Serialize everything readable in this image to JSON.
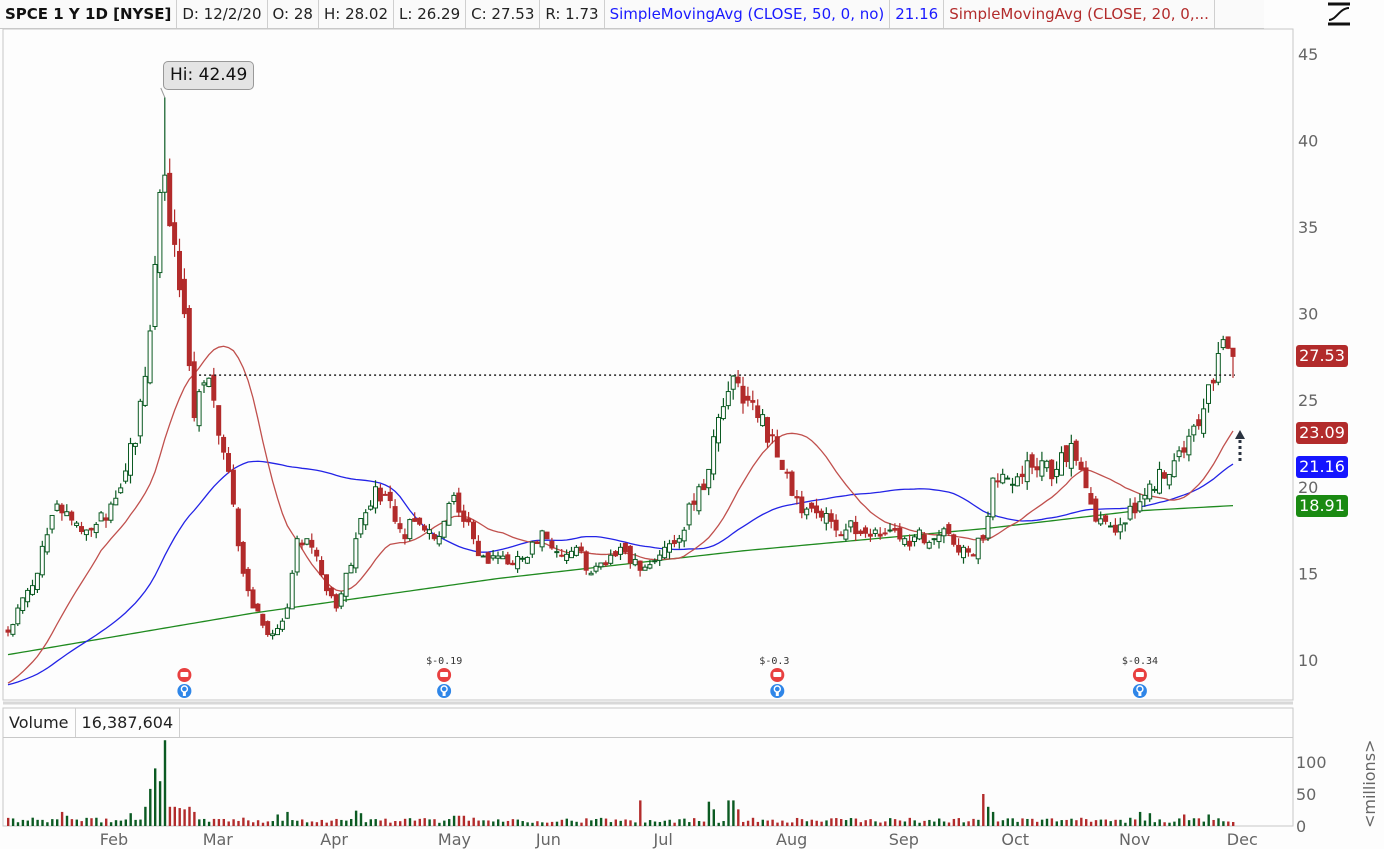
{
  "header": {
    "symbol": "SPCE 1 Y 1D [NYSE]",
    "date": "D: 12/2/20",
    "open": "O: 28",
    "high": "H: 28.02",
    "low": "L: 26.29",
    "close": "C: 27.53",
    "range": "R: 1.73",
    "sma50_label": "SimpleMovingAvg (CLOSE, 50, 0, no)",
    "sma50_value": "21.16",
    "sma20_label": "SimpleMovingAvg (CLOSE, 20, 0,..."
  },
  "studies_icon": "studies-curve-icon",
  "volume_panel": {
    "label": "Volume",
    "value": "16,387,604",
    "unit": "<millions>"
  },
  "hi_callout": "Hi: 42.49",
  "price_badges": {
    "last": "27.53",
    "sma20": "23.09",
    "sma50": "21.16",
    "sma200": "18.91"
  },
  "colors": {
    "up": "#0b5a22",
    "down": "#b22b2b",
    "sma20": "#c0504d",
    "sma50": "#2323e6",
    "sma200": "#1f8a1f",
    "badge_last": "#b22b2b",
    "badge_sma20": "#b22b2b",
    "badge_sma50": "#1515ff",
    "badge_sma200": "#1a8a12",
    "earnings_red": "#e84040",
    "earnings_blue": "#2f86e8"
  },
  "chart_data": {
    "type": "candlestick",
    "title": "SPCE 1 Y 1D [NYSE]",
    "price_ticks": [
      10,
      15,
      20,
      25,
      30,
      35,
      40,
      45
    ],
    "ylim": [
      8,
      46.5
    ],
    "volume_ticks": [
      0,
      50,
      100
    ],
    "volume_ylim": [
      0,
      160
    ],
    "x_ticks": [
      {
        "label": "Feb",
        "day": 22
      },
      {
        "label": "Mar",
        "day": 43
      },
      {
        "label": "Apr",
        "day": 67
      },
      {
        "label": "May",
        "day": 91
      },
      {
        "label": "Jun",
        "day": 111
      },
      {
        "label": "Jul",
        "day": 135
      },
      {
        "label": "Aug",
        "day": 160
      },
      {
        "label": "Sep",
        "day": 183
      },
      {
        "label": "Oct",
        "day": 206
      },
      {
        "label": "Nov",
        "day": 230
      },
      {
        "label": "Dec",
        "day": 252
      }
    ],
    "num_days": 251,
    "close_anchors": [
      [
        0,
        11.6
      ],
      [
        6,
        15
      ],
      [
        10,
        19
      ],
      [
        16,
        17.5
      ],
      [
        21,
        19
      ],
      [
        26,
        22.5
      ],
      [
        29,
        29
      ],
      [
        31,
        37
      ],
      [
        32,
        38
      ],
      [
        34,
        34
      ],
      [
        36,
        30
      ],
      [
        38,
        24
      ],
      [
        40,
        26
      ],
      [
        42,
        25
      ],
      [
        44,
        22
      ],
      [
        46,
        19
      ],
      [
        48,
        15
      ],
      [
        50,
        13
      ],
      [
        52,
        12
      ],
      [
        54,
        11.5
      ],
      [
        57,
        13
      ],
      [
        59,
        17
      ],
      [
        61,
        17
      ],
      [
        63,
        16
      ],
      [
        65,
        14
      ],
      [
        67,
        13
      ],
      [
        69,
        15
      ],
      [
        71,
        17
      ],
      [
        73,
        18.5
      ],
      [
        75,
        20
      ],
      [
        77,
        19.5
      ],
      [
        79,
        18
      ],
      [
        81,
        17
      ],
      [
        83,
        18
      ],
      [
        85,
        17.5
      ],
      [
        87,
        17
      ],
      [
        89,
        18
      ],
      [
        91,
        19.5
      ],
      [
        93,
        18
      ],
      [
        95,
        17
      ],
      [
        97,
        16
      ],
      [
        100,
        16
      ],
      [
        103,
        15.5
      ],
      [
        107,
        16.8
      ],
      [
        110,
        17
      ],
      [
        113,
        16
      ],
      [
        116,
        16.5
      ],
      [
        119,
        15
      ],
      [
        122,
        15.5
      ],
      [
        125,
        16.5
      ],
      [
        128,
        15.8
      ],
      [
        131,
        15.5
      ],
      [
        134,
        16.5
      ],
      [
        137,
        17
      ],
      [
        139,
        19
      ],
      [
        141,
        20
      ],
      [
        143,
        21
      ],
      [
        145,
        24
      ],
      [
        147,
        25.5
      ],
      [
        149,
        26
      ],
      [
        151,
        25
      ],
      [
        153,
        24
      ],
      [
        156,
        23
      ],
      [
        158,
        21
      ],
      [
        160,
        19.5
      ],
      [
        162,
        18.5
      ],
      [
        165,
        18.5
      ],
      [
        168,
        18
      ],
      [
        171,
        17.5
      ],
      [
        174,
        17.3
      ],
      [
        177,
        17.5
      ],
      [
        180,
        17.5
      ],
      [
        183,
        17
      ],
      [
        186,
        17.5
      ],
      [
        189,
        17
      ],
      [
        192,
        17.3
      ],
      [
        195,
        16.5
      ],
      [
        197,
        16
      ],
      [
        199,
        17
      ],
      [
        201,
        20.5
      ],
      [
        204,
        20.5
      ],
      [
        208,
        21.5
      ],
      [
        211,
        21.5
      ],
      [
        214,
        21
      ],
      [
        217,
        22.5
      ],
      [
        219,
        21
      ],
      [
        221,
        19
      ],
      [
        224,
        18
      ],
      [
        227,
        17.8
      ],
      [
        230,
        18.5
      ],
      [
        232,
        19.5
      ],
      [
        235,
        21
      ],
      [
        238,
        21.5
      ],
      [
        240,
        22
      ],
      [
        242,
        23.5
      ],
      [
        244,
        24.5
      ],
      [
        246,
        26
      ],
      [
        248,
        28.5
      ],
      [
        249,
        28
      ],
      [
        250,
        27.53
      ]
    ],
    "last_bar": {
      "open": 28,
      "high": 28.02,
      "low": 26.29,
      "close": 27.53
    },
    "year_high": {
      "day": 32,
      "value": 42.49
    },
    "sma200_anchors": [
      [
        0,
        10.3
      ],
      [
        50,
        12.7
      ],
      [
        100,
        14.7
      ],
      [
        150,
        16.3
      ],
      [
        200,
        17.6
      ],
      [
        230,
        18.6
      ],
      [
        250,
        18.91
      ]
    ],
    "sma_start_pad": 8.5,
    "resistance_level": 26.45,
    "volume_base": 9,
    "volume_spikes": [
      [
        11,
        22
      ],
      [
        12,
        16
      ],
      [
        25,
        20
      ],
      [
        28,
        30
      ],
      [
        29,
        58
      ],
      [
        30,
        90
      ],
      [
        31,
        70
      ],
      [
        32,
        134
      ],
      [
        33,
        30
      ],
      [
        34,
        30
      ],
      [
        35,
        28
      ],
      [
        36,
        26
      ],
      [
        37,
        30
      ],
      [
        38,
        22
      ],
      [
        55,
        18
      ],
      [
        57,
        22
      ],
      [
        71,
        24
      ],
      [
        72,
        20
      ],
      [
        91,
        16
      ],
      [
        92,
        16
      ],
      [
        93,
        16
      ],
      [
        129,
        40
      ],
      [
        143,
        38
      ],
      [
        144,
        26
      ],
      [
        147,
        40
      ],
      [
        148,
        40
      ],
      [
        149,
        26
      ],
      [
        199,
        50
      ],
      [
        200,
        30
      ],
      [
        201,
        22
      ],
      [
        231,
        22
      ],
      [
        233,
        20
      ],
      [
        240,
        18
      ],
      [
        245,
        18
      ]
    ],
    "earnings": [
      {
        "day": 36,
        "label": ""
      },
      {
        "day": 89,
        "label": "$-0.19"
      },
      {
        "day": 157,
        "label": "$-0.3"
      },
      {
        "day": 231,
        "label": "$-0.34"
      }
    ]
  }
}
